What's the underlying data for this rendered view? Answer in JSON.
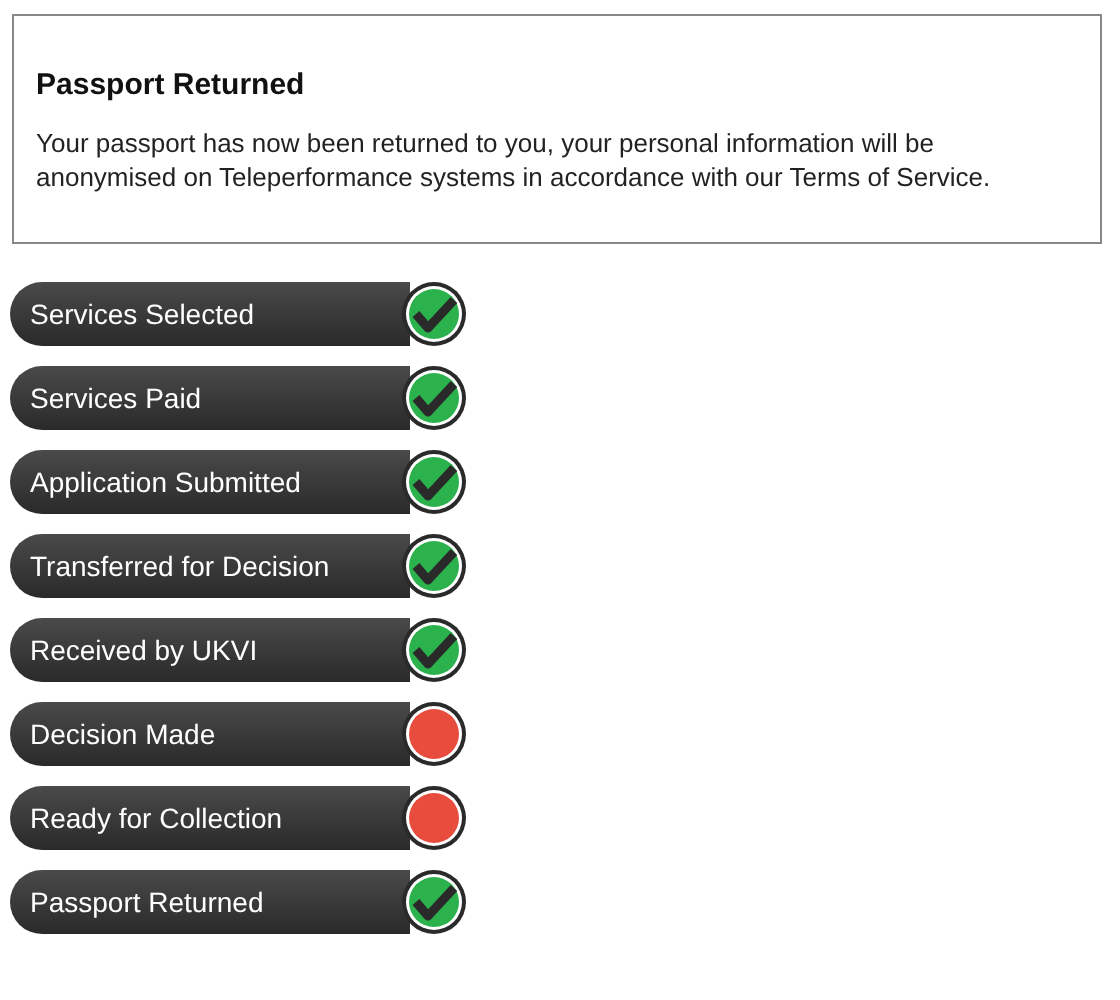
{
  "notice": {
    "title": "Passport Returned",
    "message": "Your passport has now been returned to you, your personal information will be anonymised on Teleperformance systems in accordance with our Terms of Service."
  },
  "steps": [
    {
      "label": "Services Selected",
      "done": true
    },
    {
      "label": "Services Paid",
      "done": true
    },
    {
      "label": "Application Submitted",
      "done": true
    },
    {
      "label": "Transferred for Decision",
      "done": true
    },
    {
      "label": "Received by UKVI",
      "done": true
    },
    {
      "label": "Decision Made",
      "done": false
    },
    {
      "label": "Ready for Collection",
      "done": false
    },
    {
      "label": "Passport Returned",
      "done": true
    }
  ]
}
